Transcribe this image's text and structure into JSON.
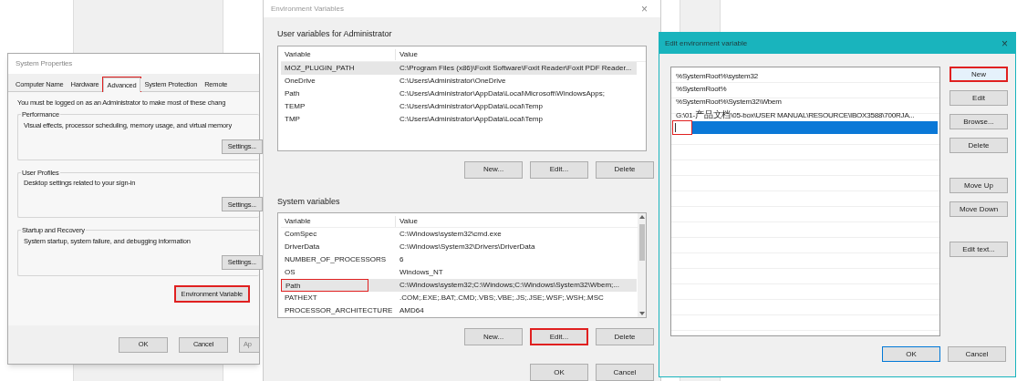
{
  "system_properties": {
    "title": "System Properties",
    "tabs": [
      {
        "label": "Computer Name",
        "selected": false,
        "highlighted": false
      },
      {
        "label": "Hardware",
        "selected": false,
        "highlighted": false
      },
      {
        "label": "Advanced",
        "selected": true,
        "highlighted": true
      },
      {
        "label": "System Protection",
        "selected": false,
        "highlighted": false
      },
      {
        "label": "Remote",
        "selected": false,
        "highlighted": false
      }
    ],
    "notice": "You must be logged on as an Administrator to make most of these chang",
    "groups": [
      {
        "title": "Performance",
        "description": "Visual effects, processor scheduling, memory usage, and virtual memory",
        "button": "Settings..."
      },
      {
        "title": "User Profiles",
        "description": "Desktop settings related to your sign-in",
        "button": "Settings..."
      },
      {
        "title": "Startup and Recovery",
        "description": "System startup, system failure, and debugging information",
        "button": "Settings..."
      }
    ],
    "env_button": {
      "label": "Environment Variable",
      "highlighted": true
    },
    "buttons": [
      {
        "label": "OK",
        "disabled": false
      },
      {
        "label": "Cancel",
        "disabled": false
      },
      {
        "label": "Ap",
        "disabled": true
      }
    ]
  },
  "environment_variables": {
    "title": "Environment Variables",
    "close": "×",
    "user_variables": {
      "label": "User variables for Administrator",
      "columns": [
        "Variable",
        "Value"
      ],
      "rows": [
        {
          "variable": "MOZ_PLUGIN_PATH",
          "value": "C:\\Program Files (x86)\\Foxit Software\\Foxit Reader\\Foxit PDF Reader...",
          "selected": true,
          "highlighted": false
        },
        {
          "variable": "OneDrive",
          "value": "C:\\Users\\Administrator\\OneDrive",
          "selected": false,
          "highlighted": false
        },
        {
          "variable": "Path",
          "value": "C:\\Users\\Administrator\\AppData\\Local\\Microsoft\\WindowsApps;",
          "selected": false,
          "highlighted": false
        },
        {
          "variable": "TEMP",
          "value": "C:\\Users\\Administrator\\AppData\\Local\\Temp",
          "selected": false,
          "highlighted": false
        },
        {
          "variable": "TMP",
          "value": "C:\\Users\\Administrator\\AppData\\Local\\Temp",
          "selected": false,
          "highlighted": false
        }
      ],
      "buttons": [
        {
          "label": "New...",
          "highlighted": false
        },
        {
          "label": "Edit...",
          "highlighted": false
        },
        {
          "label": "Delete",
          "highlighted": false
        }
      ]
    },
    "system_variables": {
      "label": "System variables",
      "columns": [
        "Variable",
        "Value"
      ],
      "rows": [
        {
          "variable": "ComSpec",
          "value": "C:\\Windows\\system32\\cmd.exe",
          "selected": false,
          "highlighted": false
        },
        {
          "variable": "DriverData",
          "value": "C:\\Windows\\System32\\Drivers\\DriverData",
          "selected": false,
          "highlighted": false
        },
        {
          "variable": "NUMBER_OF_PROCESSORS",
          "value": "6",
          "selected": false,
          "highlighted": false
        },
        {
          "variable": "OS",
          "value": "Windows_NT",
          "selected": false,
          "highlighted": false
        },
        {
          "variable": "Path",
          "value": "C:\\Windows\\system32;C:\\Windows;C:\\Windows\\System32\\Wbem;...",
          "selected": true,
          "highlighted": true
        },
        {
          "variable": "PATHEXT",
          "value": ".COM;.EXE;.BAT;.CMD;.VBS;.VBE;.JS;.JSE;.WSF;.WSH;.MSC",
          "selected": false,
          "highlighted": false
        },
        {
          "variable": "PROCESSOR_ARCHITECTURE",
          "value": "AMD64",
          "selected": false,
          "highlighted": false
        }
      ],
      "buttons": [
        {
          "label": "New...",
          "highlighted": false
        },
        {
          "label": "Edit...",
          "highlighted": true
        },
        {
          "label": "Delete",
          "highlighted": false
        }
      ]
    },
    "buttons": [
      {
        "label": "OK"
      },
      {
        "label": "Cancel"
      }
    ]
  },
  "edit_variable": {
    "title": "Edit environment variable",
    "close": "×",
    "entries": [
      {
        "kind": "text",
        "text": "%SystemRoot%\\system32",
        "selected": false
      },
      {
        "kind": "text",
        "text": "%SystemRoot%",
        "selected": false
      },
      {
        "kind": "text",
        "text": "%SystemRoot%\\System32\\Wbem",
        "selected": false
      },
      {
        "kind": "text",
        "text": "G:\\01-产品文档\\05-box\\USER MANUAL\\RESOURCE\\IBOX3588\\700RJA...",
        "selected": false
      },
      {
        "kind": "editor",
        "selected": true,
        "highlighted": true
      }
    ],
    "side_button_groups": [
      [
        {
          "label": "New",
          "focused": true,
          "highlighted": true
        },
        {
          "label": "Edit",
          "focused": false,
          "highlighted": false
        },
        {
          "label": "Browse...",
          "focused": false,
          "highlighted": false
        },
        {
          "label": "Delete",
          "focused": false,
          "highlighted": false
        }
      ],
      [
        {
          "label": "Move Up",
          "focused": false,
          "highlighted": false
        },
        {
          "label": "Move Down",
          "focused": false,
          "highlighted": false
        }
      ],
      [
        {
          "label": "Edit text...",
          "focused": false,
          "highlighted": false
        }
      ]
    ],
    "buttons": [
      {
        "label": "OK",
        "default": true
      },
      {
        "label": "Cancel",
        "default": false
      }
    ]
  }
}
